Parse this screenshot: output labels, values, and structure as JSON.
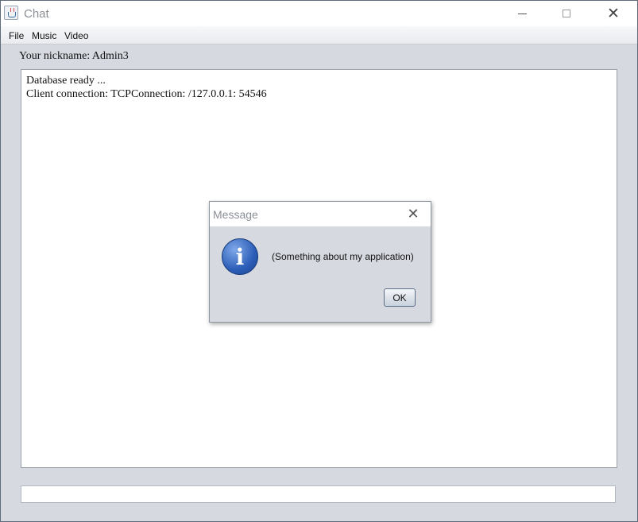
{
  "window": {
    "title": "Chat",
    "icon": "java-cup-icon",
    "close_glyph": "✕"
  },
  "menubar": {
    "items": [
      "File",
      "Music",
      "Video"
    ]
  },
  "main": {
    "nickname_label": "Your nickname: Admin3",
    "log_lines": [
      "Database ready ...",
      "Client connection: TCPConnection: /127.0.0.1: 54546"
    ],
    "message_input_value": ""
  },
  "dialog": {
    "title": "Message",
    "close_glyph": "✕",
    "icon": "info-icon",
    "icon_glyph": "i",
    "message": "(Something about my application)",
    "ok_label": "OK"
  }
}
